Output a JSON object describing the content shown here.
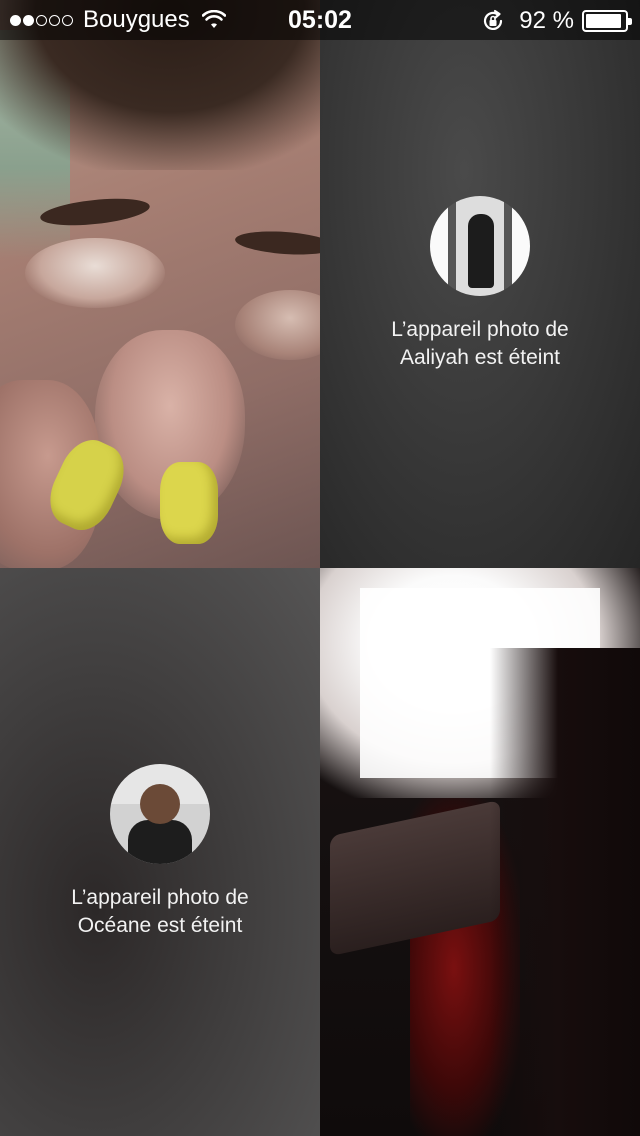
{
  "status_bar": {
    "signal_bars_filled": 2,
    "signal_bars_total": 5,
    "carrier": "Bouygues",
    "time": "05:02",
    "battery_percent_label": "92 %",
    "battery_level": 0.92,
    "icons": [
      "signal-dots-icon",
      "wifi-icon",
      "rotation-lock-icon",
      "battery-icon"
    ]
  },
  "participants": [
    {
      "tile": "self-view",
      "camera": "on"
    },
    {
      "tile": "participant-aaliyah",
      "camera": "off",
      "label": "L’appareil photo de\nAaliyah est éteint"
    },
    {
      "tile": "participant-oceane",
      "camera": "off",
      "label": "L’appareil photo de\nOcéane est éteint"
    },
    {
      "tile": "participant-video",
      "camera": "on"
    }
  ],
  "tiles": {
    "aaliyah_line1": "L’appareil photo de",
    "aaliyah_line2": "Aaliyah est éteint",
    "oceane_line1": "L’appareil photo de",
    "oceane_line2": "Océane est éteint"
  }
}
